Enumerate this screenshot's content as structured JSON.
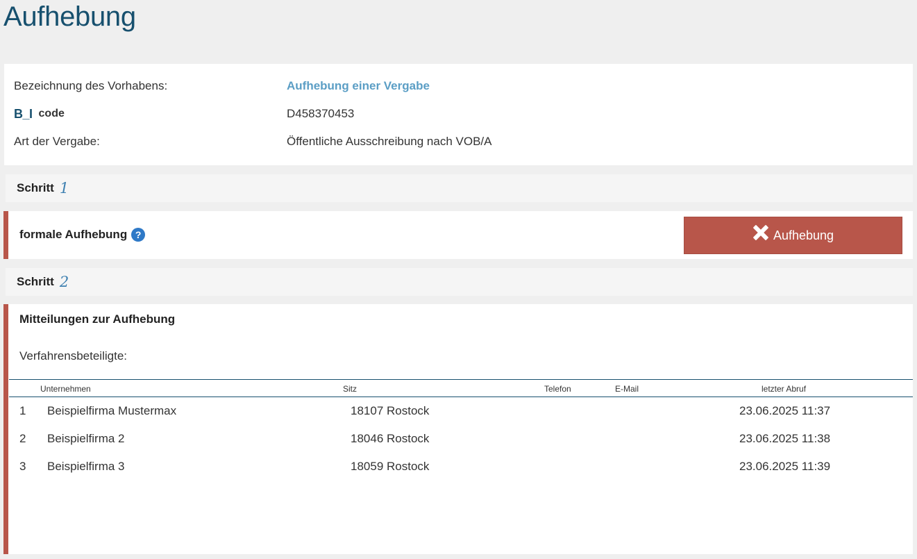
{
  "page": {
    "title": "Aufhebung"
  },
  "info": {
    "bezeichnung_label": "Bezeichnung des Vorhabens:",
    "bezeichnung_value": "Aufhebung einer Vergabe",
    "code_logo": "B_I",
    "code_label": "code",
    "code_value": "D458370453",
    "art_label": "Art der Vergabe:",
    "art_value": "Öffentliche Ausschreibung nach VOB/A"
  },
  "step1": {
    "label": "Schritt",
    "number": "1",
    "formal_label": "formale Aufhebung",
    "help_icon": "?",
    "button_label": "Aufhebung"
  },
  "step2": {
    "label": "Schritt",
    "number": "2",
    "title": "Mitteilungen zur Aufhebung",
    "beteiligte_label": "Verfahrensbeteiligte:"
  },
  "table": {
    "headers": [
      "Unternehmen",
      "Sitz",
      "Telefon",
      "E-Mail",
      "letzter Abruf"
    ],
    "rows": [
      {
        "nr": "1",
        "unternehmen": "Beispielfirma Mustermax",
        "sitz": "18107 Rostock",
        "telefon": "",
        "email": "",
        "abruf": "23.06.2025 11:37"
      },
      {
        "nr": "2",
        "unternehmen": "Beispielfirma 2",
        "sitz": "18046 Rostock",
        "telefon": "",
        "email": "",
        "abruf": "23.06.2025 11:38"
      },
      {
        "nr": "3",
        "unternehmen": "Beispielfirma 3",
        "sitz": "18059 Rostock",
        "telefon": "",
        "email": "",
        "abruf": "23.06.2025 11:39"
      }
    ]
  },
  "colors": {
    "accent": "#b8564a",
    "title": "#17506e",
    "link": "#5b9ec5"
  }
}
